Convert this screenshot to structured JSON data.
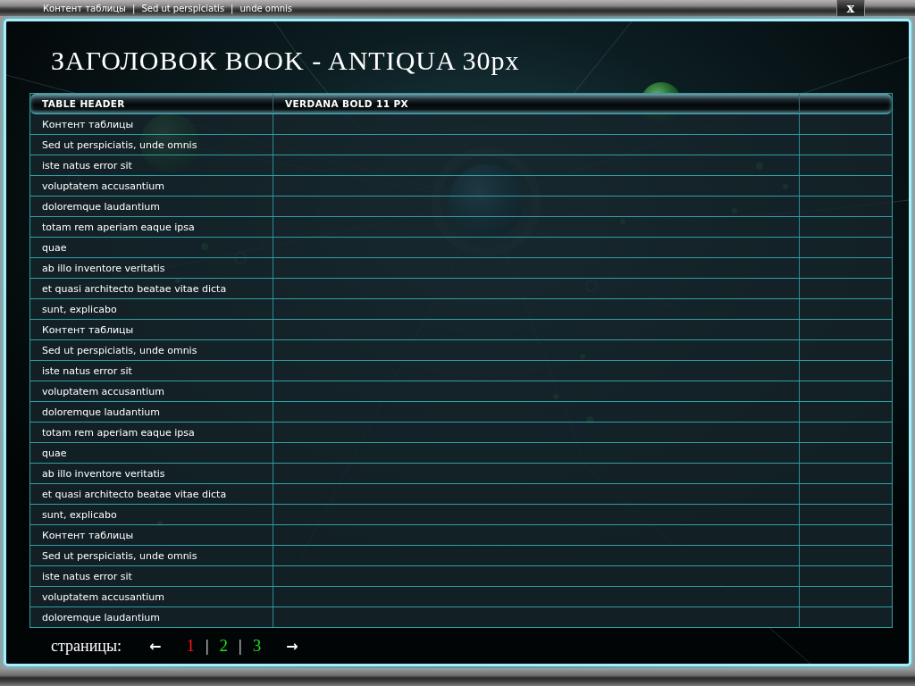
{
  "top_nav": {
    "links": [
      "Контент таблицы",
      "Sed ut perspiciatis",
      "unde omnis"
    ],
    "separators": [
      "|",
      "|"
    ]
  },
  "close_button": {
    "label": "x"
  },
  "title": "ЗАГОЛОВОК BOOK - ANTIQUA 30px",
  "table": {
    "columns": [
      "TABLE HEADER",
      "VERDANA BOLD 11 PX"
    ],
    "rows": [
      "Контент таблицы",
      "Sed ut perspiciatis, unde omnis",
      "iste natus error sit",
      "voluptatem accusantium",
      "doloremque laudantium",
      "totam rem aperiam eaque ipsa",
      "quae",
      "ab illo inventore veritatis",
      "et quasi architecto beatae vitae dicta",
      "sunt, explicabo",
      "Контент таблицы",
      "Sed ut perspiciatis, unde omnis",
      "iste natus error sit",
      "voluptatem accusantium",
      "doloremque laudantium",
      "totam rem aperiam eaque ipsa",
      "quae",
      "ab illo inventore veritatis",
      "et quasi architecto beatae vitae dicta",
      "sunt, explicabo",
      "Контент таблицы",
      "Sed ut perspiciatis, unde omnis",
      "iste natus error sit",
      "voluptatem accusantium",
      "doloremque laudantium"
    ]
  },
  "pagination": {
    "label": "страницы:",
    "prev": "←",
    "pages": [
      {
        "label": "1",
        "selected": true
      },
      {
        "label": "2",
        "selected": false
      },
      {
        "label": "3",
        "selected": false
      }
    ],
    "separators": [
      "|",
      "|"
    ],
    "next": "→"
  }
}
